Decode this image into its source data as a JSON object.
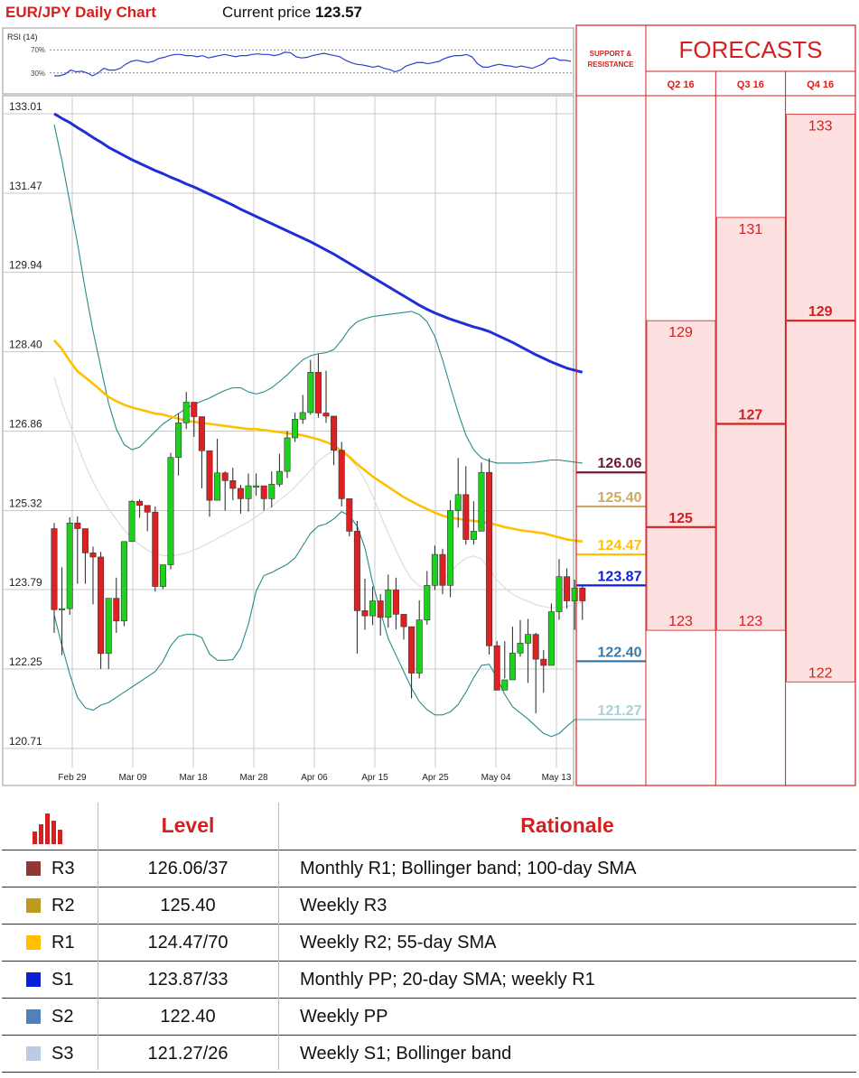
{
  "header": {
    "title": "EUR/JPY Daily Chart",
    "price_label": "Current price",
    "price_value": "123.57"
  },
  "rsi": {
    "label": "RSI (14)",
    "upper": "70%",
    "lower": "30%",
    "values": [
      25,
      25,
      28,
      35,
      32,
      33,
      30,
      25,
      30,
      38,
      35,
      35,
      38,
      45,
      50,
      52,
      50,
      48,
      50,
      55,
      57,
      60,
      62,
      62,
      60,
      60,
      58,
      60,
      56,
      58,
      60,
      62,
      60,
      58,
      60,
      60,
      62,
      63,
      62,
      62,
      60,
      62,
      66,
      65,
      58,
      56,
      57,
      60,
      62,
      64,
      62,
      60,
      58,
      52,
      48,
      45,
      44,
      42,
      40,
      42,
      38,
      36,
      32,
      35,
      42,
      45,
      48,
      48,
      46,
      48,
      50,
      55,
      58,
      60,
      60,
      62,
      58,
      46,
      40,
      40,
      43,
      45,
      43,
      42,
      40,
      42,
      40,
      38,
      42,
      46,
      55,
      56,
      52,
      52,
      50
    ]
  },
  "chart_data": {
    "type": "candlestick",
    "title": "EUR/JPY Daily Chart",
    "y_ticks": [
      "133.01",
      "131.47",
      "129.94",
      "128.40",
      "126.86",
      "125.32",
      "123.79",
      "122.25",
      "120.71"
    ],
    "ylim": [
      120.71,
      133.01
    ],
    "x_ticks": [
      "Feb 29",
      "Mar 09",
      "Mar 18",
      "Mar 28",
      "Apr 06",
      "Apr 15",
      "Apr 25",
      "May 04",
      "May 13"
    ],
    "candles": [
      [
        124.97,
        123.4,
        125.08,
        122.95
      ],
      [
        123.4,
        123.42,
        124.22,
        122.52
      ],
      [
        123.42,
        125.08,
        125.19,
        123.3
      ],
      [
        125.08,
        124.97,
        125.21,
        123.9
      ],
      [
        124.97,
        124.5,
        124.52,
        123.9
      ],
      [
        124.5,
        124.42,
        124.62,
        123.5
      ],
      [
        124.42,
        122.55,
        124.52,
        122.25
      ],
      [
        122.55,
        123.62,
        123.62,
        122.25
      ],
      [
        123.62,
        123.18,
        124.02,
        122.95
      ],
      [
        123.18,
        124.72,
        124.72,
        123.08
      ],
      [
        124.72,
        125.5,
        125.52,
        124.72
      ],
      [
        125.5,
        125.42,
        125.54,
        125.18
      ],
      [
        125.42,
        125.29,
        125.32,
        124.92
      ],
      [
        125.29,
        123.85,
        125.4,
        123.75
      ],
      [
        123.85,
        124.27,
        124.27,
        123.8
      ],
      [
        124.27,
        126.35,
        126.44,
        124.18
      ],
      [
        126.35,
        127.02,
        127.2,
        126.0
      ],
      [
        127.02,
        127.42,
        127.62,
        126.9
      ],
      [
        127.42,
        127.14,
        127.3,
        126.75
      ],
      [
        127.14,
        126.48,
        126.62,
        125.75
      ],
      [
        126.48,
        125.52,
        126.04,
        125.2
      ],
      [
        125.52,
        126.05,
        126.71,
        125.91
      ],
      [
        126.05,
        125.9,
        126.08,
        125.32
      ],
      [
        125.9,
        125.75,
        126.15,
        125.52
      ],
      [
        125.75,
        125.55,
        125.82,
        125.26
      ],
      [
        125.55,
        125.8,
        126.04,
        125.3
      ],
      [
        125.8,
        125.8,
        126.04,
        125.61
      ],
      [
        125.8,
        125.55,
        125.8,
        125.32
      ],
      [
        125.55,
        125.83,
        126.08,
        125.38
      ],
      [
        125.83,
        126.08,
        126.42,
        125.78
      ],
      [
        126.08,
        126.73,
        126.86,
        125.95
      ],
      [
        126.73,
        127.09,
        127.22,
        126.65
      ],
      [
        127.09,
        127.22,
        127.56,
        127.0
      ],
      [
        127.22,
        128.0,
        128.24,
        127.18
      ],
      [
        128.0,
        127.21,
        128.35,
        127.12
      ],
      [
        127.21,
        127.15,
        128.03,
        127.02
      ],
      [
        127.15,
        126.49,
        126.95,
        126.2
      ],
      [
        126.49,
        125.55,
        126.65,
        125.4
      ],
      [
        125.55,
        124.92,
        125.44,
        124.82
      ],
      [
        124.92,
        123.38,
        125.12,
        122.55
      ],
      [
        123.38,
        123.28,
        124.0,
        123.01
      ],
      [
        123.28,
        123.57,
        123.85,
        123.1
      ],
      [
        123.57,
        123.25,
        123.7,
        122.9
      ],
      [
        123.25,
        123.78,
        124.08,
        123.05
      ],
      [
        123.78,
        123.31,
        124.02,
        123.02
      ],
      [
        123.31,
        123.07,
        123.22,
        122.82
      ],
      [
        123.07,
        122.17,
        122.6,
        121.68
      ],
      [
        122.17,
        123.2,
        123.58,
        122.07
      ],
      [
        123.2,
        123.87,
        124.15,
        123.11
      ],
      [
        123.87,
        124.47,
        124.64,
        123.78
      ],
      [
        124.47,
        123.87,
        124.58,
        123.7
      ],
      [
        123.87,
        125.32,
        125.52,
        123.64
      ],
      [
        125.32,
        125.63,
        126.34,
        124.99
      ],
      [
        125.63,
        124.76,
        126.18,
        124.66
      ],
      [
        124.76,
        124.92,
        125.5,
        124.66
      ],
      [
        124.92,
        126.06,
        126.25,
        125.42
      ],
      [
        126.06,
        122.7,
        126.33,
        122.53
      ],
      [
        122.7,
        121.84,
        122.79,
        121.84
      ],
      [
        121.84,
        122.04,
        122.79,
        122.07
      ],
      [
        122.04,
        122.56,
        123.07,
        122.4
      ],
      [
        122.56,
        122.75,
        123.2,
        122.49
      ],
      [
        122.75,
        122.92,
        123.22,
        121.98
      ],
      [
        122.92,
        122.44,
        122.95,
        121.39
      ],
      [
        122.44,
        122.32,
        122.62,
        121.79
      ],
      [
        122.32,
        123.36,
        123.52,
        122.39
      ],
      [
        123.36,
        124.04,
        124.38,
        123.2
      ],
      [
        124.04,
        123.57,
        124.2,
        123.42
      ],
      [
        123.57,
        123.82,
        123.98,
        123.01
      ],
      [
        123.82,
        123.57,
        123.85,
        123.2
      ]
    ],
    "sma200": [
      133.01,
      132.92,
      132.84,
      132.74,
      132.65,
      132.55,
      132.46,
      132.36,
      132.28,
      132.2,
      132.12,
      132.05,
      131.98,
      131.91,
      131.85,
      131.78,
      131.72,
      131.65,
      131.59,
      131.52,
      131.45,
      131.38,
      131.31,
      131.24,
      131.16,
      131.09,
      131.02,
      130.95,
      130.88,
      130.81,
      130.74,
      130.67,
      130.6,
      130.53,
      130.45,
      130.37,
      130.29,
      130.2,
      130.11,
      130.02,
      129.93,
      129.84,
      129.75,
      129.66,
      129.57,
      129.48,
      129.39,
      129.3,
      129.22,
      129.15,
      129.09,
      129.03,
      128.98,
      128.93,
      128.88,
      128.84,
      128.79,
      128.72,
      128.65,
      128.58,
      128.5,
      128.42,
      128.34,
      128.27,
      128.2,
      128.14,
      128.08,
      128.04,
      128.0
    ],
    "sma55": [
      128.62,
      128.45,
      128.22,
      128.02,
      127.9,
      127.78,
      127.65,
      127.52,
      127.44,
      127.37,
      127.32,
      127.28,
      127.24,
      127.2,
      127.18,
      127.14,
      127.1,
      127.06,
      127.04,
      127.02,
      127.0,
      126.98,
      126.96,
      126.94,
      126.92,
      126.9,
      126.9,
      126.88,
      126.86,
      126.84,
      126.82,
      126.8,
      126.78,
      126.74,
      126.7,
      126.65,
      126.58,
      126.48,
      126.36,
      126.22,
      126.1,
      125.98,
      125.88,
      125.78,
      125.68,
      125.58,
      125.5,
      125.42,
      125.35,
      125.28,
      125.22,
      125.18,
      125.16,
      125.14,
      125.12,
      125.1,
      125.08,
      125.04,
      125.0,
      124.97,
      124.94,
      124.92,
      124.9,
      124.88,
      124.84,
      124.8,
      124.76,
      124.74,
      124.72
    ],
    "sma20": [
      127.9,
      127.4,
      127.0,
      126.6,
      126.2,
      125.88,
      125.6,
      125.35,
      125.15,
      124.95,
      124.78,
      124.66,
      124.55,
      124.48,
      124.45,
      124.44,
      124.46,
      124.5,
      124.56,
      124.62,
      124.7,
      124.78,
      124.86,
      124.94,
      125.02,
      125.1,
      125.2,
      125.3,
      125.4,
      125.52,
      125.64,
      125.78,
      125.94,
      126.1,
      126.28,
      126.4,
      126.48,
      126.46,
      126.34,
      126.16,
      125.92,
      125.6,
      125.24,
      124.88,
      124.55,
      124.24,
      124.0,
      123.86,
      123.82,
      123.85,
      123.96,
      124.12,
      124.28,
      124.4,
      124.44,
      124.38,
      124.18,
      123.98,
      123.82,
      123.7,
      123.62,
      123.56,
      123.5,
      123.46,
      123.44,
      123.44,
      123.46,
      123.5,
      123.55
    ],
    "bb_upper": [
      132.8,
      132.1,
      131.3,
      130.5,
      129.6,
      128.8,
      128.1,
      127.4,
      126.9,
      126.6,
      126.5,
      126.55,
      126.7,
      126.85,
      127.0,
      127.1,
      127.2,
      127.3,
      127.38,
      127.44,
      127.5,
      127.58,
      127.65,
      127.7,
      127.7,
      127.62,
      127.58,
      127.62,
      127.7,
      127.82,
      127.95,
      128.1,
      128.24,
      128.32,
      128.36,
      128.38,
      128.44,
      128.62,
      128.84,
      128.98,
      129.04,
      129.08,
      129.1,
      129.12,
      129.14,
      129.16,
      129.18,
      129.12,
      128.98,
      128.7,
      128.24,
      127.72,
      127.22,
      126.78,
      126.5,
      126.34,
      126.28,
      126.24,
      126.24,
      126.24,
      126.24,
      126.25,
      126.26,
      126.28,
      126.3,
      126.3,
      126.28,
      126.26,
      126.24
    ],
    "bb_lower": [
      123.3,
      122.7,
      122.15,
      121.7,
      121.5,
      121.45,
      121.55,
      121.6,
      121.7,
      121.8,
      121.9,
      122.0,
      122.1,
      122.2,
      122.4,
      122.7,
      122.88,
      122.92,
      122.92,
      122.86,
      122.54,
      122.42,
      122.42,
      122.43,
      122.66,
      123.12,
      123.76,
      124.06,
      124.12,
      124.2,
      124.28,
      124.4,
      124.64,
      124.88,
      125.02,
      125.06,
      125.16,
      125.3,
      125.22,
      125.02,
      124.6,
      123.92,
      123.36,
      122.84,
      122.52,
      122.2,
      121.88,
      121.62,
      121.46,
      121.36,
      121.36,
      121.42,
      121.56,
      121.8,
      122.08,
      122.32,
      122.34,
      122.08,
      121.76,
      121.52,
      121.4,
      121.28,
      121.14,
      121.0,
      120.94,
      121.0,
      121.14,
      121.27,
      121.28
    ],
    "levels": [
      {
        "name": "R3",
        "value": 126.06,
        "label": "126.06",
        "color": "#6b1c3a"
      },
      {
        "name": "R2",
        "value": 125.4,
        "label": "125.40",
        "color": "#cfa95e"
      },
      {
        "name": "R1",
        "value": 124.47,
        "label": "124.47",
        "color": "#ffc000"
      },
      {
        "name": "S1",
        "value": 123.87,
        "label": "123.87",
        "color": "#0b1fd6"
      },
      {
        "name": "S2",
        "value": 122.4,
        "label": "122.40",
        "color": "#3a7aa8"
      },
      {
        "name": "S3",
        "value": 121.27,
        "label": "121.27",
        "color": "#a9d3d8"
      }
    ]
  },
  "panel": {
    "sr_label_1": "SUPPORT &",
    "sr_label_2": "RESISTANCE",
    "forecasts_title": "FORECASTS",
    "quarters": [
      {
        "label": "Q2 16",
        "high": "129",
        "mid": "125",
        "low": "123",
        "high_v": 129,
        "mid_v": 125,
        "low_v": 123
      },
      {
        "label": "Q3 16",
        "high": "131",
        "mid": "127",
        "low": "123",
        "high_v": 131,
        "mid_v": 127,
        "low_v": 123
      },
      {
        "label": "Q4 16",
        "high": "133",
        "mid": "129",
        "low": "122",
        "high_v": 133,
        "mid_v": 129,
        "low_v": 122
      }
    ]
  },
  "table": {
    "col_level": "Level",
    "col_rationale": "Rationale",
    "rows": [
      {
        "name": "R3",
        "level": "126.06/37",
        "rationale": "Monthly R1; Bollinger band; 100-day SMA",
        "color": "#943634"
      },
      {
        "name": "R2",
        "level": "125.40",
        "rationale": "Weekly R3",
        "color": "#c09a1e"
      },
      {
        "name": "R1",
        "level": "124.47/70",
        "rationale": "Weekly R2; 55-day SMA",
        "color": "#ffc000"
      },
      {
        "name": "S1",
        "level": "123.87/33",
        "rationale": "Monthly PP; 20-day SMA; weekly R1",
        "color": "#0b1fd6"
      },
      {
        "name": "S2",
        "level": "122.40",
        "rationale": "Weekly PP",
        "color": "#4f81bd"
      },
      {
        "name": "S3",
        "level": "121.27/26",
        "rationale": "Weekly S1; Bollinger band",
        "color": "#b8cce4"
      }
    ]
  },
  "colors": {
    "bull": "#1fd11f",
    "bear": "#e02020",
    "accent": "#d42020",
    "band": "#2a8a8a",
    "sma200": "#1f2fd6",
    "sma55": "#ffc000",
    "forecast_fill": "#fde0e0"
  }
}
